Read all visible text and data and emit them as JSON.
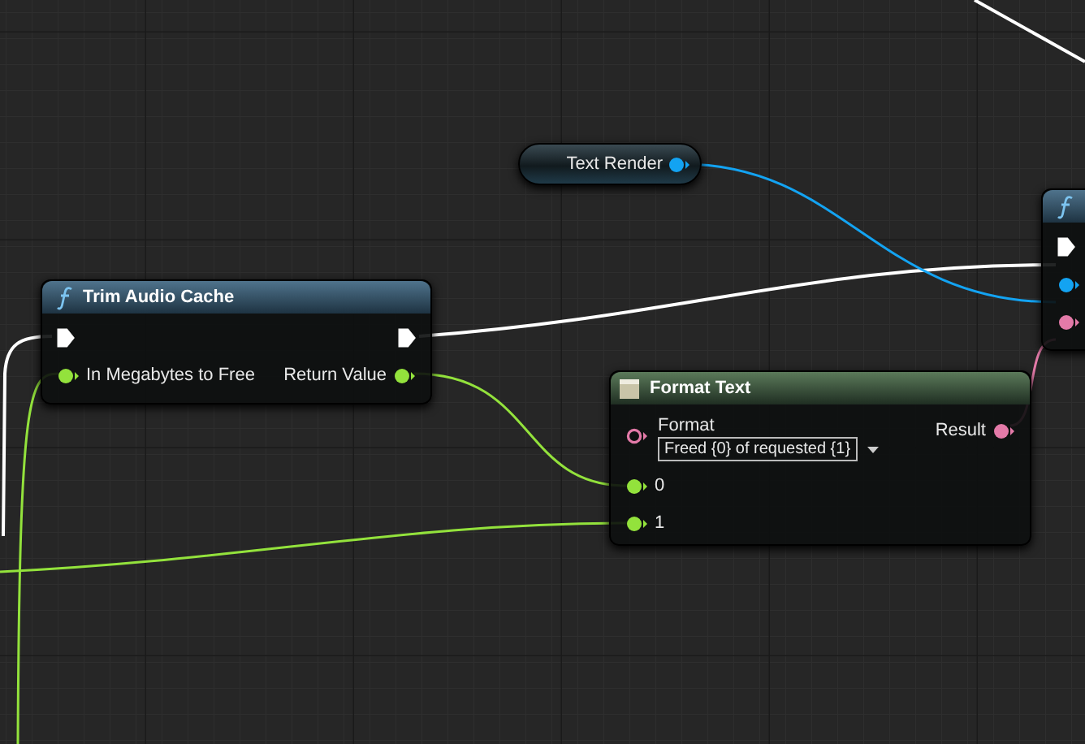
{
  "graph": {
    "nodes": [
      {
        "kind": "function",
        "title": "Trim Audio Cache",
        "inputs": [
          {
            "kind": "exec",
            "connected": true
          },
          {
            "kind": "data",
            "label": "In Megabytes to Free",
            "color": "#93e23c",
            "connected": true
          }
        ],
        "outputs": [
          {
            "kind": "exec",
            "connected": true
          },
          {
            "kind": "data",
            "label": "Return Value",
            "color": "#93e23c",
            "connected": true
          }
        ]
      },
      {
        "kind": "variable",
        "title": "Text Render",
        "color": "#13a3f2",
        "connected": true
      },
      {
        "kind": "format",
        "title": "Format Text",
        "format_label": "Format",
        "format_value": "Freed {0} of requested {1}",
        "format_pin": {
          "color": "#e37aa8",
          "connected": false
        },
        "result_label": "Result",
        "result_pin": {
          "color": "#e37aa8",
          "connected": true
        },
        "arguments": [
          {
            "label": "0",
            "color": "#93e23c",
            "connected": true
          },
          {
            "label": "1",
            "color": "#93e23c",
            "connected": true
          }
        ]
      },
      {
        "kind": "function",
        "inputs": [
          {
            "kind": "exec",
            "connected": true
          },
          {
            "kind": "data",
            "color": "#13a3f2",
            "connected": true
          },
          {
            "kind": "data",
            "color": "#e37aa8",
            "connected": true
          }
        ]
      }
    ]
  }
}
